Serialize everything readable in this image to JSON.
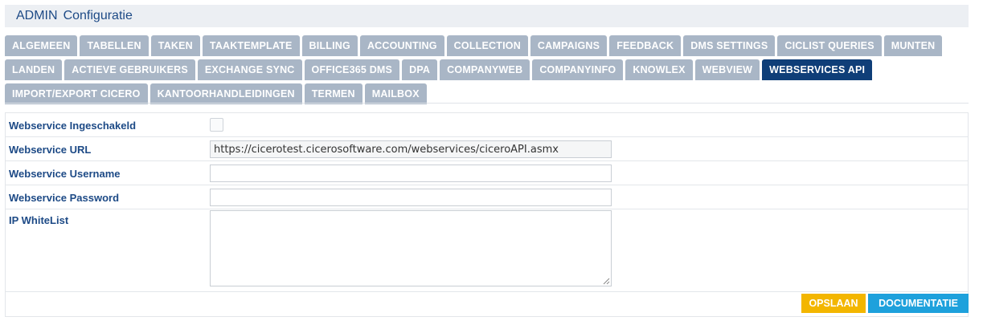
{
  "header": {
    "title_part1": "ADMIN",
    "title_part2": "Configuratie"
  },
  "tabs": {
    "row1": [
      "ALGEMEEN",
      "TABELLEN",
      "TAKEN",
      "TAAKTEMPLATE",
      "BILLING",
      "ACCOUNTING",
      "COLLECTION",
      "CAMPAIGNS",
      "FEEDBACK",
      "DMS SETTINGS",
      "CICLIST QUERIES",
      "MUNTEN"
    ],
    "row2": [
      "LANDEN",
      "ACTIEVE GEBRUIKERS",
      "EXCHANGE SYNC",
      "OFFICE365 DMS",
      "DPA",
      "COMPANYWEB",
      "COMPANYINFO",
      "KNOWLEX",
      "WEBVIEW",
      "WEBSERVICES API"
    ],
    "row3": [
      "IMPORT/EXPORT CICERO",
      "KANTOORHANDLEIDINGEN",
      "TERMEN",
      "MAILBOX"
    ],
    "active": "WEBSERVICES API"
  },
  "form": {
    "enabled_label": "Webservice Ingeschakeld",
    "enabled_checked": false,
    "url_label": "Webservice URL",
    "url_value": "https://cicerotest.cicerosoftware.com/webservices/ciceroAPI.asmx",
    "username_label": "Webservice Username",
    "username_value": "",
    "password_label": "Webservice Password",
    "password_value": "",
    "whitelist_label": "IP WhiteList",
    "whitelist_value": ""
  },
  "buttons": {
    "save": "OPSLAAN",
    "documentation": "DOCUMENTATIE"
  },
  "colors": {
    "tab_inactive": "#a9b6c6",
    "tab_active": "#0f3e78",
    "label_text": "#1d4a86",
    "save_button": "#f3b600",
    "documentation_button": "#1ea1dc"
  }
}
